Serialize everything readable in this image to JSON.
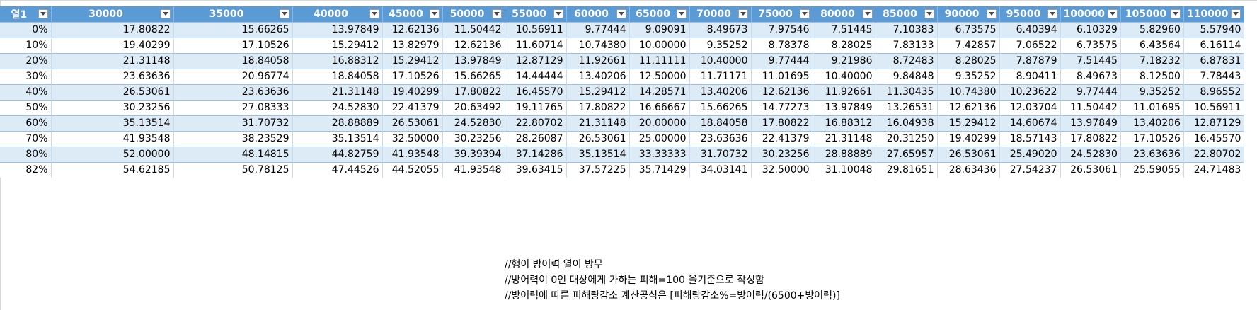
{
  "table": {
    "corner_label": "열1",
    "columns": [
      "30000",
      "35000",
      "40000",
      "45000",
      "50000",
      "55000",
      "60000",
      "65000",
      "70000",
      "75000",
      "80000",
      "85000",
      "90000",
      "95000",
      "100000",
      "105000",
      "110000"
    ],
    "rows": [
      {
        "label": "0%",
        "values": [
          "17.80822",
          "15.66265",
          "13.97849",
          "12.62136",
          "11.50442",
          "10.56911",
          "9.77444",
          "9.09091",
          "8.49673",
          "7.97546",
          "7.51445",
          "7.10383",
          "6.73575",
          "6.40394",
          "6.10329",
          "5.82960",
          "5.57940"
        ]
      },
      {
        "label": "10%",
        "values": [
          "19.40299",
          "17.10526",
          "15.29412",
          "13.82979",
          "12.62136",
          "11.60714",
          "10.74380",
          "10.00000",
          "9.35252",
          "8.78378",
          "8.28025",
          "7.83133",
          "7.42857",
          "7.06522",
          "6.73575",
          "6.43564",
          "6.16114"
        ]
      },
      {
        "label": "20%",
        "values": [
          "21.31148",
          "18.84058",
          "16.88312",
          "15.29412",
          "13.97849",
          "12.87129",
          "11.92661",
          "11.11111",
          "10.40000",
          "9.77444",
          "9.21986",
          "8.72483",
          "8.28025",
          "7.87879",
          "7.51445",
          "7.18232",
          "6.87831"
        ]
      },
      {
        "label": "30%",
        "values": [
          "23.63636",
          "20.96774",
          "18.84058",
          "17.10526",
          "15.66265",
          "14.44444",
          "13.40206",
          "12.50000",
          "11.71171",
          "11.01695",
          "10.40000",
          "9.84848",
          "9.35252",
          "8.90411",
          "8.49673",
          "8.12500",
          "7.78443"
        ]
      },
      {
        "label": "40%",
        "values": [
          "26.53061",
          "23.63636",
          "21.31148",
          "19.40299",
          "17.80822",
          "16.45570",
          "15.29412",
          "14.28571",
          "13.40206",
          "12.62136",
          "11.92661",
          "11.30435",
          "10.74380",
          "10.23622",
          "9.77444",
          "9.35252",
          "8.96552"
        ]
      },
      {
        "label": "50%",
        "values": [
          "30.23256",
          "27.08333",
          "24.52830",
          "22.41379",
          "20.63492",
          "19.11765",
          "17.80822",
          "16.66667",
          "15.66265",
          "14.77273",
          "13.97849",
          "13.26531",
          "12.62136",
          "12.03704",
          "11.50442",
          "11.01695",
          "10.56911"
        ]
      },
      {
        "label": "60%",
        "values": [
          "35.13514",
          "31.70732",
          "28.88889",
          "26.53061",
          "24.52830",
          "22.80702",
          "21.31148",
          "20.00000",
          "18.84058",
          "17.80822",
          "16.88312",
          "16.04938",
          "15.29412",
          "14.60674",
          "13.97849",
          "13.40206",
          "12.87129"
        ]
      },
      {
        "label": "70%",
        "values": [
          "41.93548",
          "38.23529",
          "35.13514",
          "32.50000",
          "30.23256",
          "28.26087",
          "26.53061",
          "25.00000",
          "23.63636",
          "22.41379",
          "21.31148",
          "20.31250",
          "19.40299",
          "18.57143",
          "17.80822",
          "17.10526",
          "16.45570"
        ]
      },
      {
        "label": "80%",
        "values": [
          "52.00000",
          "48.14815",
          "44.82759",
          "41.93548",
          "39.39394",
          "37.14286",
          "35.13514",
          "33.33333",
          "31.70732",
          "30.23256",
          "28.88889",
          "27.65957",
          "26.53061",
          "25.49020",
          "24.52830",
          "23.63636",
          "22.80702"
        ]
      },
      {
        "label": "82%",
        "values": [
          "54.62185",
          "50.78125",
          "47.44526",
          "44.52055",
          "41.93548",
          "39.63415",
          "37.57225",
          "35.71429",
          "34.03141",
          "32.50000",
          "31.10048",
          "29.81651",
          "28.63436",
          "27.54237",
          "26.53061",
          "25.59055",
          "24.71483"
        ]
      }
    ]
  },
  "notes": [
    "//행이 방어력 열이 방무",
    "//방어력이 0인 대상에게 가하는 피해=100 을기준으로 작성함",
    "//방어력에 따른 피해량감소 계산공식은 [피해량감소%=방어력/(6500+방어력)]"
  ],
  "colors": {
    "header_bg": "#5b9bd5",
    "band_row": "#ddebf7",
    "grid_line": "#d8d8d8"
  }
}
